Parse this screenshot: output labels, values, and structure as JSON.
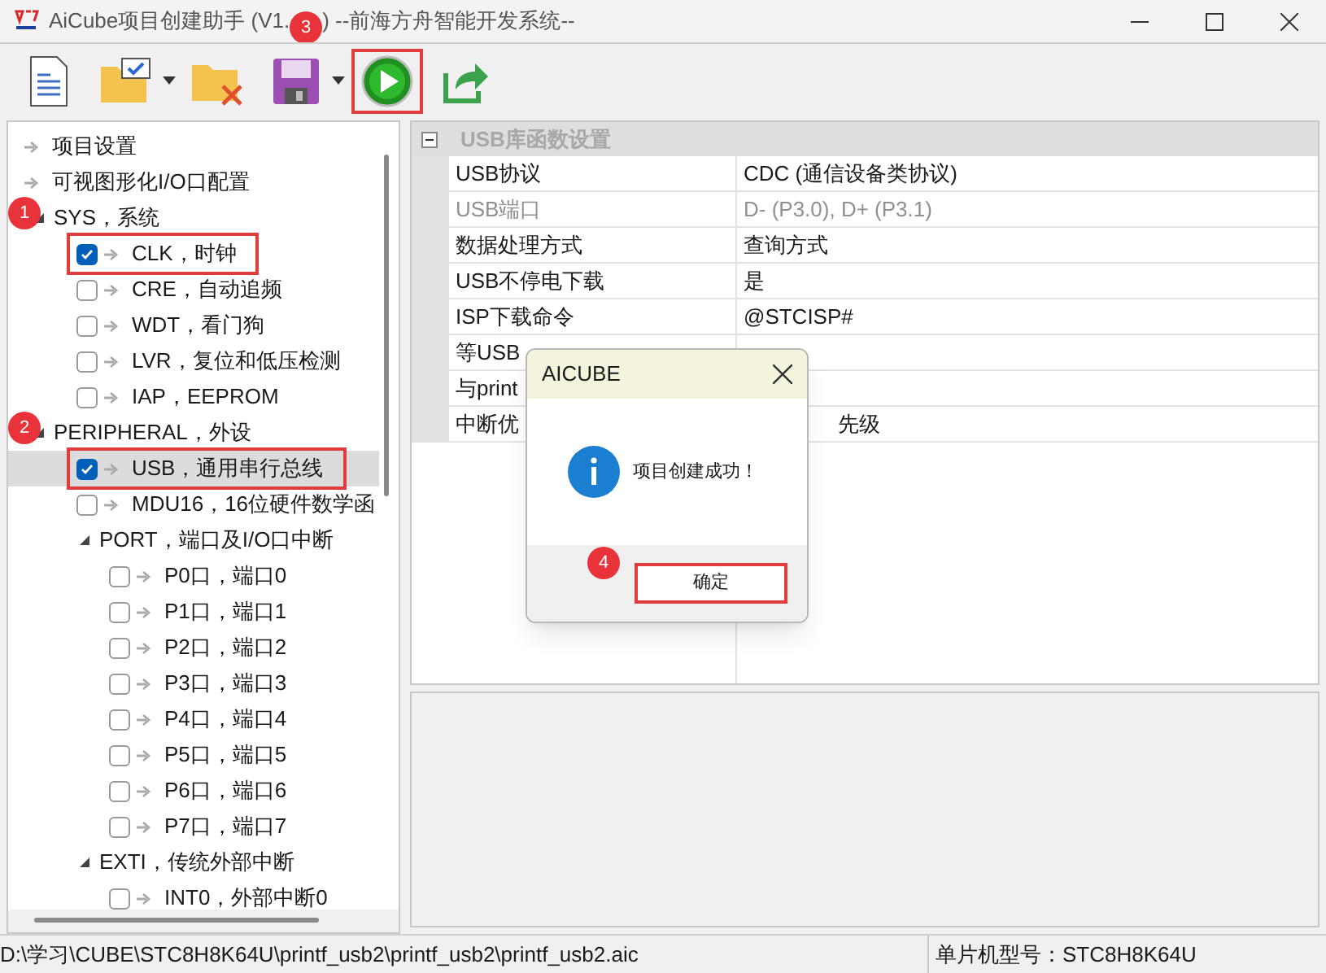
{
  "window": {
    "title_before": "AiCube项目创建助手 (V1.",
    "title_after": ") --前海方舟智能开发系统--",
    "title_marker": "3"
  },
  "toolbar": [
    {
      "kind": "new",
      "dropdown": false,
      "highlighted": false
    },
    {
      "kind": "open",
      "dropdown": true,
      "highlighted": false
    },
    {
      "kind": "delete",
      "dropdown": false,
      "highlighted": false
    },
    {
      "kind": "save",
      "dropdown": true,
      "highlighted": false
    },
    {
      "kind": "run",
      "dropdown": false,
      "highlighted": true
    },
    {
      "kind": "export",
      "dropdown": false,
      "highlighted": false
    }
  ],
  "tree": [
    {
      "kind": "leaf",
      "label": "项目设置"
    },
    {
      "kind": "leaf",
      "label": "可视图形化I/O口配置"
    },
    {
      "kind": "group",
      "label": "SYS，系统",
      "marker": "1",
      "expanded": true,
      "children": [
        {
          "kind": "check",
          "label": "CLK，时钟",
          "checked": true,
          "highlighted": true,
          "selected": false
        },
        {
          "kind": "check",
          "label": "CRE，自动追频",
          "checked": false,
          "highlighted": false,
          "selected": false
        },
        {
          "kind": "check",
          "label": "WDT，看门狗",
          "checked": false,
          "highlighted": false,
          "selected": false
        },
        {
          "kind": "check",
          "label": "LVR，复位和低压检测",
          "checked": false,
          "highlighted": false,
          "selected": false
        },
        {
          "kind": "check",
          "label": "IAP，EEPROM",
          "checked": false,
          "highlighted": false,
          "selected": false
        }
      ]
    },
    {
      "kind": "group",
      "label": "PERIPHERAL，外设",
      "marker": "2",
      "expanded": true,
      "children": [
        {
          "kind": "check",
          "label": "USB，通用串行总线",
          "checked": true,
          "highlighted": true,
          "selected": true
        },
        {
          "kind": "check",
          "label": "MDU16，16位硬件数学函",
          "checked": false,
          "highlighted": false,
          "selected": false
        },
        {
          "kind": "group",
          "label": "PORT，端口及I/O口中断",
          "expanded": true,
          "children": [
            {
              "kind": "check",
              "label": "P0口，端口0",
              "checked": false,
              "highlighted": false,
              "selected": false
            },
            {
              "kind": "check",
              "label": "P1口，端口1",
              "checked": false,
              "highlighted": false,
              "selected": false
            },
            {
              "kind": "check",
              "label": "P2口，端口2",
              "checked": false,
              "highlighted": false,
              "selected": false
            },
            {
              "kind": "check",
              "label": "P3口，端口3",
              "checked": false,
              "highlighted": false,
              "selected": false
            },
            {
              "kind": "check",
              "label": "P4口，端口4",
              "checked": false,
              "highlighted": false,
              "selected": false
            },
            {
              "kind": "check",
              "label": "P5口，端口5",
              "checked": false,
              "highlighted": false,
              "selected": false
            },
            {
              "kind": "check",
              "label": "P6口，端口6",
              "checked": false,
              "highlighted": false,
              "selected": false
            },
            {
              "kind": "check",
              "label": "P7口，端口7",
              "checked": false,
              "highlighted": false,
              "selected": false
            }
          ]
        },
        {
          "kind": "group",
          "label": "EXTI，传统外部中断",
          "expanded": true,
          "children": [
            {
              "kind": "check",
              "label": "INT0，外部中断0",
              "checked": false,
              "highlighted": false,
              "selected": false
            }
          ]
        }
      ]
    }
  ],
  "properties": {
    "category": "USB库函数设置",
    "expanded": true,
    "rows": [
      {
        "label": "USB协议",
        "value": "CDC (通信设备类协议)",
        "disabled": false
      },
      {
        "label": "USB端口",
        "value": "D- (P3.0), D+ (P3.1)",
        "disabled": true
      },
      {
        "label": "数据处理方式",
        "value": "查询方式",
        "disabled": false
      },
      {
        "label": "USB不停电下载",
        "value": "是",
        "disabled": false
      },
      {
        "label": "ISP下载命令",
        "value": "@STCISP#",
        "disabled": false
      },
      {
        "label": "等USB",
        "disabled": false
      },
      {
        "label": "与print",
        "disabled": false
      },
      {
        "label": "中断优",
        "value": "先级",
        "disabled": false
      }
    ]
  },
  "dialog": {
    "title": "AICUBE",
    "message": "项目创建成功！",
    "button": "确定",
    "button_highlighted": true,
    "marker": "4"
  },
  "status_bar": {
    "path": "D:\\学习\\CUBE\\STC8H8K64U\\printf_usb2\\printf_usb2\\printf_usb2.aic",
    "chip": "单片机型号：STC8H8K64U"
  }
}
